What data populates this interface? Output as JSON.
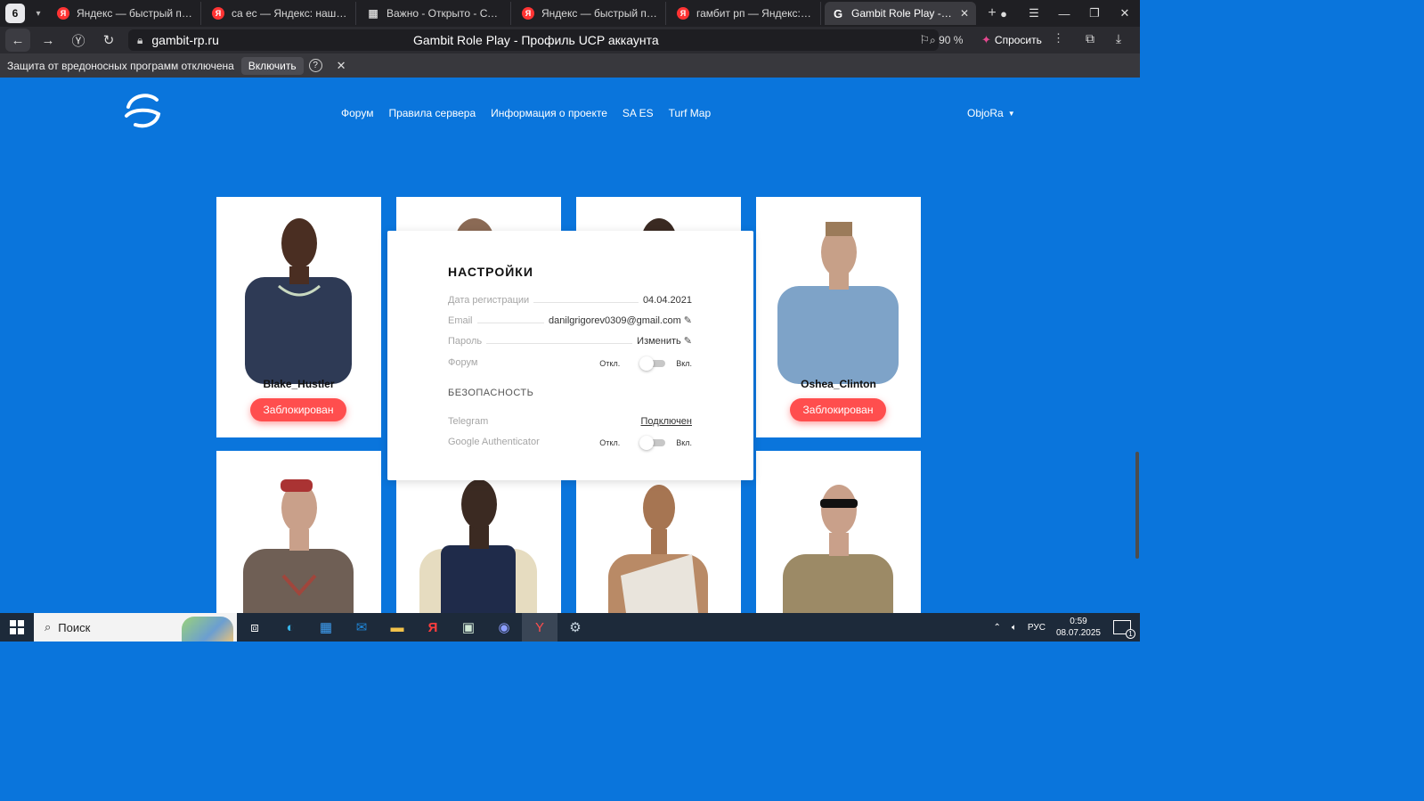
{
  "browser": {
    "tab_count": "6",
    "tabs": [
      {
        "title": "Яндекс — быстрый поиск",
        "icon": "yandex-icon"
      },
      {
        "title": "са ес — Яндекс: нашлось",
        "icon": "yandex-icon"
      },
      {
        "title": "Важно - Открыто - СТАРТ",
        "icon": "grid-icon"
      },
      {
        "title": "Яндекс — быстрый поиск",
        "icon": "yandex-icon"
      },
      {
        "title": "гамбит рп — Яндекс: наш",
        "icon": "yandex-icon"
      },
      {
        "title": "Gambit Role Play - Проф",
        "icon": "gambit-icon",
        "active": true
      }
    ],
    "url_domain": "gambit-rp.ru",
    "page_title": "Gambit Role Play - Профиль UCP аккаунта",
    "zoom": "90 %",
    "ask_label": "Спросить",
    "warning": {
      "text": "Защита от вредоносных программ отключена",
      "button": "Включить"
    }
  },
  "site": {
    "nav": [
      "Форум",
      "Правила сервера",
      "Информация о проекте",
      "SA ES",
      "Turf Map"
    ],
    "user": "ObjoRa",
    "accent_color": "#0a75dc",
    "ban_color": "#ff4e4e"
  },
  "characters": [
    {
      "name": "Blake_Hustler",
      "status": "Заблокирован",
      "skin": "#2e3a55",
      "tone": "#4a2e22"
    },
    {
      "name": "",
      "status": "",
      "skin": "#5e6a78",
      "tone": "#8b6a55"
    },
    {
      "name": "",
      "status": "",
      "skin": "#333",
      "tone": "#3a2a22"
    },
    {
      "name": "Oshea_Clinton",
      "status": "Заблокирован",
      "skin": "#7ea3c8",
      "tone": "#c7a088"
    },
    {
      "name": "",
      "status": "",
      "skin": "#6f5f55",
      "tone": "#c9a08a"
    },
    {
      "name": "",
      "status": "",
      "skin": "#1f2b4a",
      "tone": "#3b2a22"
    },
    {
      "name": "",
      "status": "",
      "skin": "#e9e4dc",
      "tone": "#a67552"
    },
    {
      "name": "",
      "status": "",
      "skin": "#9c8a66",
      "tone": "#c9a08a"
    }
  ],
  "settings": {
    "title": "НАСТРОЙКИ",
    "reg_label": "Дата регистрации",
    "reg_value": "04.04.2021",
    "email_label": "Email",
    "email_value": "danilgrigorev0309@gmail.com",
    "password_label": "Пароль",
    "password_value": "Изменить",
    "forum_label": "Форум",
    "off_label": "Откл.",
    "on_label": "Вкл.",
    "security_title": "БЕЗОПАСНОСТЬ",
    "telegram_label": "Telegram",
    "telegram_value": "Подключен",
    "ga_label": "Google Authenticator"
  },
  "taskbar": {
    "search_placeholder": "Поиск",
    "lang": "РУС",
    "time": "0:59",
    "date": "08.07.2025",
    "notifications": "1"
  }
}
